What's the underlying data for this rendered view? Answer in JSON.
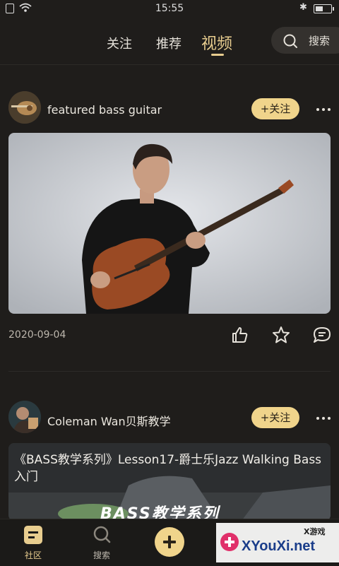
{
  "status_bar": {
    "time": "15:55"
  },
  "top_nav": {
    "tabs": [
      {
        "label": "关注"
      },
      {
        "label": "推荐"
      },
      {
        "label": "视频",
        "active": true
      }
    ],
    "search_label": "搜索"
  },
  "posts": [
    {
      "author": "featured bass guitar",
      "follow_label": "+关注",
      "date": "2020-09-04",
      "actions": [
        "thumbs-up-icon",
        "star-icon",
        "comment-icon"
      ]
    },
    {
      "author": "Coleman Wan贝斯教学",
      "follow_label": "+关注",
      "video_title": "《BASS教学系列》Lesson17-爵士乐Jazz Walking Bass入门",
      "banner_text": "BASS教学系列"
    }
  ],
  "bottom_tabs": [
    {
      "label": "社区",
      "icon": "community-icon",
      "active": true
    },
    {
      "label": "搜索",
      "icon": "search-icon"
    }
  ],
  "watermark": {
    "site": "XYouXi.net",
    "sub": "X游戏"
  },
  "colors": {
    "accent": "#e8cd8f",
    "follow_bg": "#f0d48b",
    "background": "#1f1d1b"
  }
}
